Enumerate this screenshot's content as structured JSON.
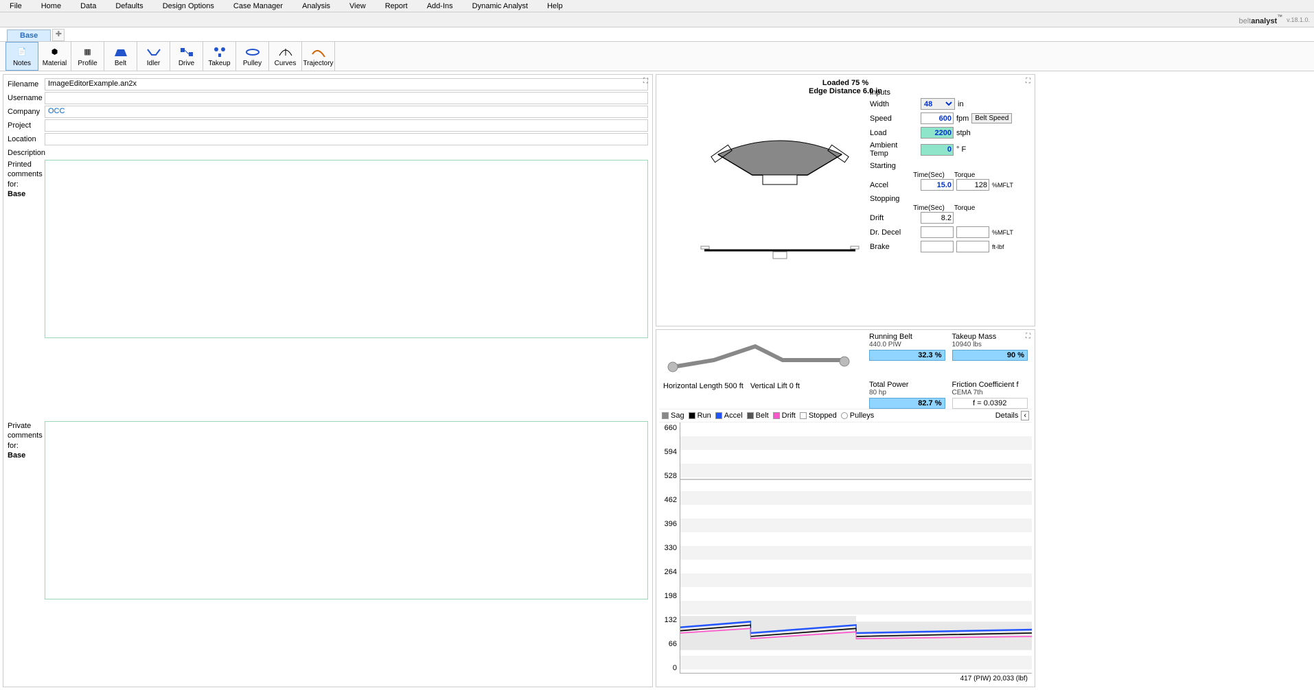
{
  "menubar": [
    "File",
    "Home",
    "Data",
    "Defaults",
    "Design Options",
    "Case Manager",
    "Analysis",
    "View",
    "Report",
    "Add-Ins",
    "Dynamic Analyst",
    "Help"
  ],
  "brand": {
    "name": "beltanalyst",
    "version": "v.18.1.0."
  },
  "tab": {
    "name": "Base",
    "add": "✚"
  },
  "toolbar": [
    {
      "id": "notes",
      "label": "Notes"
    },
    {
      "id": "material",
      "label": "Material"
    },
    {
      "id": "profile",
      "label": "Profile"
    },
    {
      "id": "belt",
      "label": "Belt"
    },
    {
      "id": "idler",
      "label": "Idler"
    },
    {
      "id": "drive",
      "label": "Drive"
    },
    {
      "id": "takeup",
      "label": "Takeup"
    },
    {
      "id": "pulley",
      "label": "Pulley"
    },
    {
      "id": "curves",
      "label": "Curves"
    },
    {
      "id": "trajectory",
      "label": "Trajectory"
    }
  ],
  "form": {
    "filename_label": "Filename",
    "filename": "ImageEditorExample.an2x",
    "username_label": "Username",
    "username": "",
    "company_label": "Company",
    "company": "OCC",
    "project_label": "Project",
    "project": "",
    "location_label": "Location",
    "location": "",
    "description_label": "Description",
    "description": "",
    "printed_label": "Printed comments for:",
    "printed_case": "Base",
    "printed": "",
    "private_label": "Private comments for:",
    "private_case": "Base",
    "private": ""
  },
  "diagram": {
    "title": "Loaded 75 %",
    "subtitle": "Edge Distance 6.0 in",
    "inputs_header": "Inputs",
    "width_label": "Width",
    "width": "48",
    "width_unit": "in",
    "speed_label": "Speed",
    "speed": "600",
    "speed_unit": "fpm",
    "belt_speed_btn": "Belt Speed",
    "load_label": "Load",
    "load": "2200",
    "load_unit": "stph",
    "ambient_label": "Ambient Temp",
    "ambient": "0",
    "ambient_unit": "° F",
    "starting_header": "Starting",
    "time_col": "Time(Sec)",
    "torque_col": "Torque",
    "accel_label": "Accel",
    "accel_time": "15.0",
    "accel_torque": "128",
    "accel_unit": "%MFLT",
    "stopping_header": "Stopping",
    "drift_label": "Drift",
    "drift_time": "8.2",
    "drdecel_label": "Dr. Decel",
    "drdecel_unit": "%MFLT",
    "brake_label": "Brake",
    "brake_unit": "ft-lbf"
  },
  "lower": {
    "running_belt_label": "Running Belt",
    "running_belt_val": "440.0 PIW",
    "running_belt_pct": "32.3 %",
    "takeup_label": "Takeup Mass",
    "takeup_val": "10940 lbs",
    "takeup_pct": "90 %",
    "total_power_label": "Total Power",
    "total_power_val": "80 hp",
    "total_power_pct": "82.7 %",
    "friction_label": "Friction Coefficient f",
    "friction_val": "CEMA 7th",
    "friction_f": "f = 0.0392",
    "horiz_label": "Horizontal Length",
    "horiz_val": "500 ft",
    "vert_label": "Vertical Lift",
    "vert_val": "0 ft",
    "legend": [
      {
        "name": "Sag",
        "color": "#888"
      },
      {
        "name": "Run",
        "color": "#000"
      },
      {
        "name": "Accel",
        "color": "#2255ff"
      },
      {
        "name": "Belt",
        "color": "#555"
      },
      {
        "name": "Drift",
        "color": "#ff55cc"
      },
      {
        "name": "Stopped",
        "color": "#fff"
      },
      {
        "name": "Pulleys",
        "color": "#fff"
      }
    ],
    "details_label": "Details",
    "footer": "417 (PIW)    20,033 (lbf)"
  },
  "chart_data": {
    "type": "line",
    "ylabel": "",
    "ylim": [
      0,
      660
    ],
    "y_ticks": [
      660,
      594,
      528,
      462,
      396,
      330,
      264,
      198,
      132,
      66,
      0
    ],
    "series": [
      {
        "name": "Run",
        "values": [
          120,
          122,
          125,
          130,
          128,
          130,
          132,
          130,
          128,
          126
        ]
      },
      {
        "name": "Accel",
        "values": [
          128,
          130,
          134,
          140,
          136,
          138,
          140,
          136,
          132,
          130
        ]
      },
      {
        "name": "Drift",
        "values": [
          116,
          118,
          120,
          124,
          122,
          124,
          126,
          124,
          122,
          120
        ]
      }
    ]
  }
}
